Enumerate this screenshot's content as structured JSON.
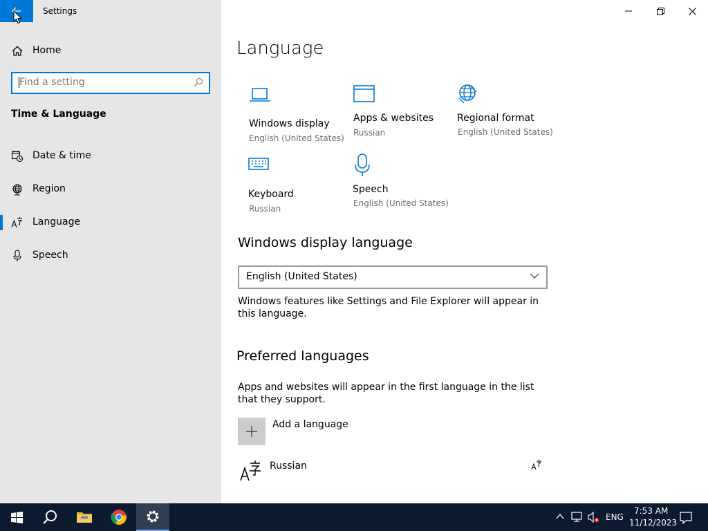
{
  "window": {
    "title": "Settings"
  },
  "sidebar": {
    "home_label": "Home",
    "search_placeholder": "Find a setting",
    "section_title": "Time & Language",
    "items": [
      {
        "label": "Date & time",
        "icon": "calendar-clock-icon"
      },
      {
        "label": "Region",
        "icon": "globe-icon"
      },
      {
        "label": "Language",
        "icon": "language-icon",
        "active": true
      },
      {
        "label": "Speech",
        "icon": "microphone-icon"
      }
    ]
  },
  "main": {
    "title": "Language",
    "tiles": [
      {
        "name": "Windows display",
        "value": "English (United States)",
        "icon": "laptop-icon"
      },
      {
        "name": "Apps & websites",
        "value": "Russian",
        "icon": "browser-window-icon"
      },
      {
        "name": "Regional format",
        "value": "English (United States)",
        "icon": "globe-icon"
      },
      {
        "name": "Keyboard",
        "value": "Russian",
        "icon": "keyboard-icon"
      },
      {
        "name": "Speech",
        "value": "English (United States)",
        "icon": "microphone-icon"
      }
    ],
    "display_language": {
      "heading": "Windows display language",
      "selected": "English (United States)",
      "description": "Windows features like Settings and File Explorer will appear in this language."
    },
    "preferred": {
      "heading": "Preferred languages",
      "description": "Apps and websites will appear in the first language in the list that they support.",
      "add_label": "Add a language",
      "languages": [
        {
          "name": "Russian"
        }
      ]
    }
  },
  "taskbar": {
    "input_indicator": "ENG",
    "time": "7:53 AM",
    "date": "11/12/2023"
  },
  "colors": {
    "accent": "#0078d7",
    "sidebar_bg": "#e6e6e6",
    "taskbar_bg": "#0b1a2e"
  }
}
